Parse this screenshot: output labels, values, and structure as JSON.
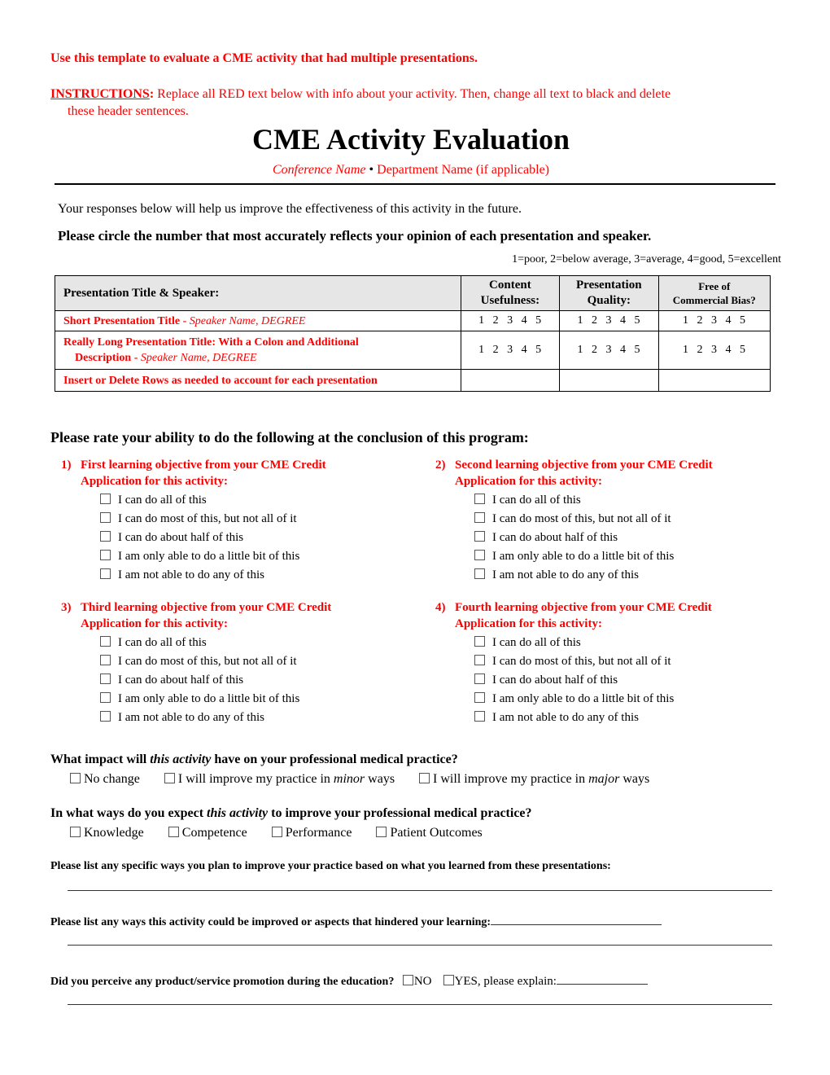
{
  "header": {
    "template_note": "Use this template to evaluate a CME activity that had multiple presentations.",
    "instructions_label": "INSTRUCTIONS",
    "instructions_text": " Replace all RED text below with info about your activity.  Then, change all text to black and delete",
    "instructions_cont": "these header sentences.",
    "title": "CME Activity Evaluation",
    "conference_name": "Conference Name",
    "separator": "•",
    "department_name": "Department Name (if applicable)"
  },
  "intro": {
    "responses_text": "Your responses below will help us improve the effectiveness of this activity in the future.",
    "circle_instruction": "Please circle the number that most accurately reflects your opinion of each presentation and speaker.",
    "scale_legend": "1=poor,  2=below average,  3=average,  4=good,  5=excellent"
  },
  "presentations_table": {
    "columns": [
      "Presentation Title & Speaker:",
      "Content Usefulness:",
      "Presentation Quality:",
      "Free of Commercial Bias?"
    ],
    "column_lines": [
      [
        "Presentation Title & Speaker:"
      ],
      [
        "Content",
        "Usefulness:"
      ],
      [
        "Presentation",
        "Quality:"
      ],
      [
        "Free of",
        "Commercial Bias?"
      ]
    ],
    "rows": [
      {
        "title": "Short Presentation Title",
        "dash": " - ",
        "speaker": "Speaker Name, DEGREE",
        "ratings": [
          "1  2  3  4   5",
          "1  2  3  4   5",
          "1  2  3  4   5"
        ]
      },
      {
        "title_line1": "Really Long Presentation Title: With a Colon and Additional",
        "title_line2": "Description",
        "dash": " - ",
        "speaker": "Speaker Name, DEGREE",
        "ratings": [
          "1  2  3  4   5",
          "1  2  3  4   5",
          "1  2  3  4   5"
        ]
      },
      {
        "title": "Insert or Delete Rows as needed to account for each presentation",
        "ratings": [
          "",
          "",
          ""
        ]
      }
    ]
  },
  "objectives_section": {
    "heading": "Please rate your ability to do the following at the conclusion of this program:",
    "objectives": [
      {
        "num": "1)",
        "line1": "First learning objective from your CME Credit",
        "line2": "Application for this activity:"
      },
      {
        "num": "2)",
        "line1": "Second learning objective from your CME Credit",
        "line2": "Application for this activity:"
      },
      {
        "num": "3)",
        "line1": "Third learning objective from your CME Credit",
        "line2": "Application for this activity:"
      },
      {
        "num": "4)",
        "line1": "Fourth learning objective from your CME Credit",
        "line2": "Application for this activity:"
      }
    ],
    "options": [
      "I can do all of this",
      "I can do most of this, but not all of it",
      "I can do about half of this",
      "I am only able to do a little bit of this",
      "I am not able to do any of this"
    ]
  },
  "impact_question": {
    "pre": "What impact will ",
    "em": "this activity",
    "post": " have on your professional medical practice?",
    "options": [
      {
        "pre": "No change",
        "em": "",
        "post": ""
      },
      {
        "pre": "I will improve my practice in ",
        "em": "minor",
        "post": " ways"
      },
      {
        "pre": "I will improve my practice in ",
        "em": "major",
        "post": " ways"
      }
    ]
  },
  "ways_question": {
    "pre": "In what ways do you expect ",
    "em": "this activity",
    "post": " to improve your professional medical practice?",
    "options": [
      "Knowledge",
      "Competence",
      "Performance",
      "Patient Outcomes"
    ]
  },
  "open_questions": {
    "specific_ways": "Please list any specific ways you plan to improve your practice based on what you learned from these presentations:",
    "improvements": "Please list any ways this activity could be improved or aspects that hindered your learning:",
    "promotion": "Did you perceive any product/service promotion during the education?",
    "promotion_no": "NO",
    "promotion_yes": "YES, please explain:"
  },
  "colors": {
    "placeholder_red": "#ff0000",
    "table_header_bg": "#e6e6e6",
    "text": "#000000"
  }
}
